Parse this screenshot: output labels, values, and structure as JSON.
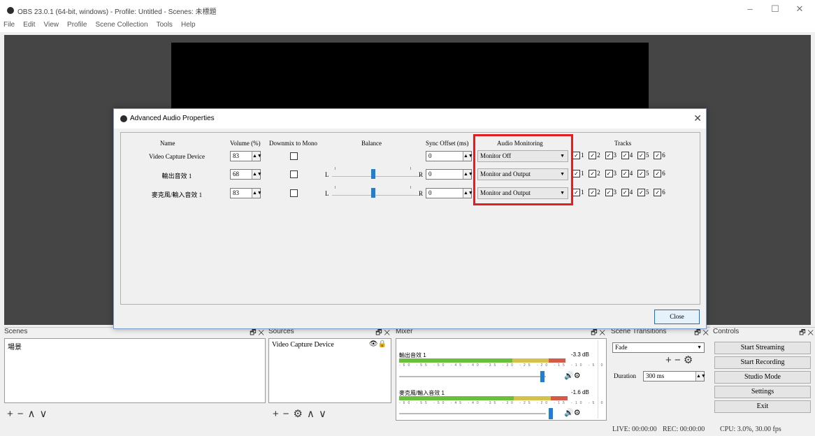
{
  "window": {
    "title": "OBS 23.0.1 (64-bit, windows) - Profile: Untitled - Scenes: 未標題"
  },
  "menu": [
    "File",
    "Edit",
    "View",
    "Profile",
    "Scene Collection",
    "Tools",
    "Help"
  ],
  "docks": {
    "scenes": {
      "title": "Scenes",
      "items": [
        "場景"
      ]
    },
    "sources": {
      "title": "Sources",
      "items": [
        "Video Capture Device"
      ]
    },
    "mixer": {
      "title": "Mixer",
      "channels": [
        {
          "name": "輸出音效 1",
          "db": "-3.3 dB",
          "level": 0.85
        },
        {
          "name": "麥克風/輸入音效 1",
          "db": "-1.6 dB",
          "level": 0.86
        }
      ],
      "ticks": "-60 -55 -50 -45 -40 -35 -30 -25 -20 -15 -10 -5 0"
    },
    "transitions": {
      "title": "Scene Transitions",
      "type": "Fade",
      "duration_label": "Duration",
      "duration_value": "300 ms"
    },
    "controls": {
      "title": "Controls",
      "buttons": [
        "Start Streaming",
        "Start Recording",
        "Studio Mode",
        "Settings",
        "Exit"
      ]
    }
  },
  "statusbar": {
    "live": "LIVE: 00:00:00",
    "rec": "REC: 00:00:00",
    "cpu": "CPU: 3.0%, 30.00 fps"
  },
  "dialog": {
    "title": "Advanced Audio Properties",
    "headers": {
      "name": "Name",
      "volume": "Volume (%)",
      "downmix": "Downmix to Mono",
      "balance": "Balance",
      "sync": "Sync Offset (ms)",
      "monitoring": "Audio Monitoring",
      "tracks": "Tracks"
    },
    "balance_left": "L",
    "balance_right": "R",
    "rows": [
      {
        "name": "Video Capture Device",
        "volume": "83",
        "sync": "0",
        "monitoring": "Monitor Off",
        "tracks": [
          "1",
          "2",
          "3",
          "4",
          "5",
          "6"
        ]
      },
      {
        "name": "輸出音效 1",
        "volume": "68",
        "sync": "0",
        "monitoring": "Monitor and Output",
        "tracks": [
          "1",
          "2",
          "3",
          "4",
          "5",
          "6"
        ]
      },
      {
        "name": "麥克風/輸入音效 1",
        "volume": "83",
        "sync": "0",
        "monitoring": "Monitor and Output",
        "tracks": [
          "1",
          "2",
          "3",
          "4",
          "5",
          "6"
        ]
      }
    ],
    "close_label": "Close"
  },
  "colors": {
    "accent": "#1f7fd4",
    "highlight": "#e02020",
    "preview_bg": "#454545"
  }
}
